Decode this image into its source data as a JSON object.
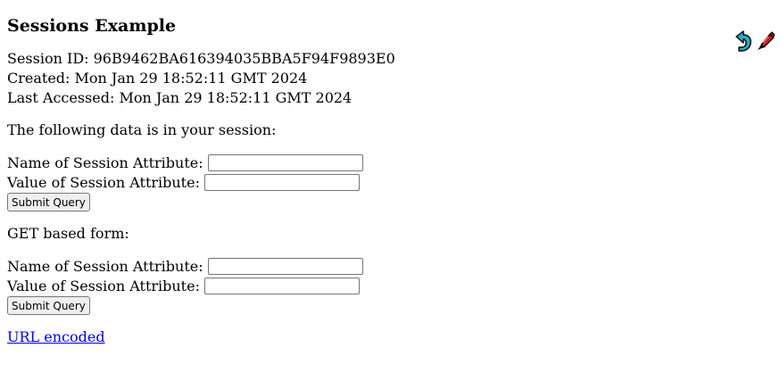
{
  "heading": "Sessions Example",
  "session": {
    "id_line": "Session ID: 96B9462BA616394035BBA5F94F9893E0",
    "created_line": "Created: Mon Jan 29 18:52:11 GMT 2024",
    "accessed_line": "Last Accessed: Mon Jan 29 18:52:11 GMT 2024"
  },
  "intro": "The following data is in your session:",
  "post_form": {
    "name_label": "Name of Session Attribute:",
    "name_value": "",
    "value_label": "Value of Session Attribute:",
    "value_value": "",
    "submit_label": "Submit Query"
  },
  "get_label": "GET based form:",
  "get_form": {
    "name_label": "Name of Session Attribute:",
    "name_value": "",
    "value_label": "Value of Session Attribute:",
    "value_value": "",
    "submit_label": "Submit Query"
  },
  "link": {
    "label": "URL encoded"
  },
  "icons": {
    "back": "back-arrow-icon",
    "source": "source-code-icon"
  }
}
